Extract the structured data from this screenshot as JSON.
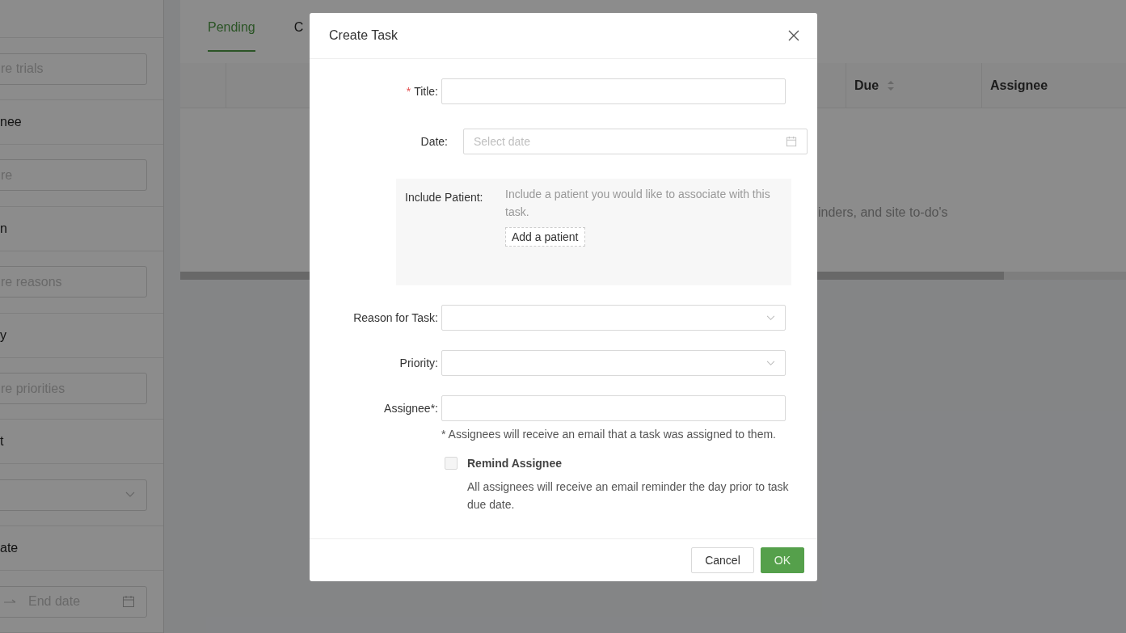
{
  "sidebar": {
    "filters": [
      {
        "kind": "field",
        "placeholder": "re trials"
      },
      {
        "kind": "heading",
        "text": "nee"
      },
      {
        "kind": "field",
        "placeholder": "re"
      },
      {
        "kind": "heading",
        "text": "n"
      },
      {
        "kind": "field",
        "placeholder": "re reasons"
      },
      {
        "kind": "heading",
        "text": "y"
      },
      {
        "kind": "field",
        "placeholder": "re priorities"
      },
      {
        "kind": "heading",
        "text": "t"
      },
      {
        "kind": "select"
      },
      {
        "kind": "heading",
        "text": "ate"
      },
      {
        "kind": "date_range",
        "placeholder": "End date"
      }
    ]
  },
  "tabs": [
    {
      "label": "Pending",
      "selected": true
    },
    {
      "label": "C",
      "selected": false
    }
  ],
  "table": {
    "columns": [
      {
        "label": "Due",
        "sortable": true
      },
      {
        "label": "Assignee",
        "sortable": false
      }
    ],
    "empty_text": "inders, and site to-do's"
  },
  "modal": {
    "title": "Create Task",
    "fields": [
      {
        "kind": "input",
        "label": "Title:",
        "required_mark": "*"
      },
      {
        "kind": "date",
        "label": "Date:",
        "placeholder": "Select date"
      },
      {
        "kind": "patient",
        "label": "Include Patient:",
        "help": "Include a patient you would like to associate with this task.",
        "button": "Add a patient"
      },
      {
        "kind": "select",
        "label": "Reason for Task:"
      },
      {
        "kind": "select",
        "label": "Priority:"
      },
      {
        "kind": "input",
        "label": "Assignee*:",
        "note": "* Assignees will receive an email that a task was assigned to them."
      }
    ],
    "remind": {
      "label": "Remind Assignee",
      "checked": false,
      "description": "All assignees will receive an email reminder the day prior to task due date."
    },
    "buttons": [
      {
        "label": "Cancel",
        "kind": "default"
      },
      {
        "label": "OK",
        "kind": "primary"
      }
    ]
  }
}
